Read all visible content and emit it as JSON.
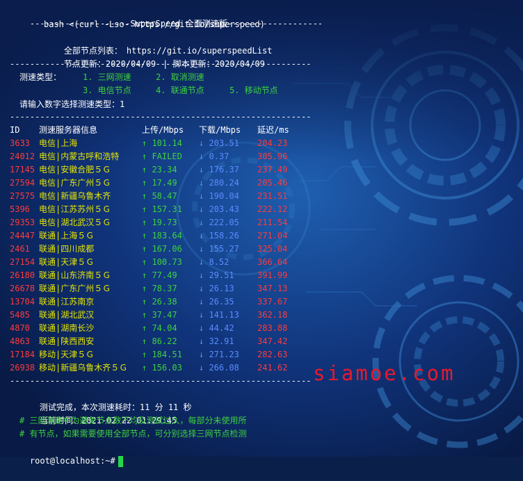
{
  "header": {
    "rule_left": "--------------------",
    "title": "SuperSpeed 全面测速版",
    "rule_right": "-------------------",
    "bash_cmd": "bash <(curl -Lso- https://git.io/superspeed)",
    "list_label": "全部节点列表：",
    "list_url": "https://git.io/superspeedList",
    "node_update": "节点更新：2020/04/09",
    "script_update": "| 脚本更新：2020/04/09"
  },
  "separator": "------------------------------------------------------------",
  "menu": {
    "type_label": "测速类型：",
    "opt1": "1. 三网测速",
    "opt2": "2. 取消测速",
    "opt3": "3. 电信节点",
    "opt4": "4. 联通节点",
    "opt5": "5. 移动节点",
    "prompt": "请输入数字选择测速类型：1"
  },
  "table": {
    "headers": {
      "id": "ID",
      "name": "测速服务器信息",
      "up": "上传/Mbps",
      "down": "下载/Mbps",
      "lat": "延迟/ms"
    },
    "rows": [
      {
        "id": "3633",
        "name": "电信|上海",
        "up": "↑ 101.14",
        "down": "↓ 203.51",
        "lat": "204.23"
      },
      {
        "id": "24012",
        "name": "电信|内蒙古呼和浩特",
        "up": "↑ FAILED",
        "down": "↓ 0.37",
        "lat": "305.96"
      },
      {
        "id": "17145",
        "name": "电信|安徽合肥５Ｇ",
        "up": "↑ 23.34",
        "down": "↓ 176.37",
        "lat": "237.49"
      },
      {
        "id": "27594",
        "name": "电信|广东广州５Ｇ",
        "up": "↑ 17.49",
        "down": "↓ 280.24",
        "lat": "205.46"
      },
      {
        "id": "27575",
        "name": "电信|新疆乌鲁木齐",
        "up": "↑ 58.47",
        "down": "↓ 190.04",
        "lat": "231.51"
      },
      {
        "id": "5396",
        "name": "电信|江苏苏州５Ｇ",
        "up": "↑ 157.31",
        "down": "↓ 203.43",
        "lat": "222.12"
      },
      {
        "id": "29353",
        "name": "电信|湖北武汉５Ｇ",
        "up": "↑ 19.73",
        "down": "↓ 222.05",
        "lat": "211.54"
      },
      {
        "id": "24447",
        "name": "联通|上海５Ｇ",
        "up": "↑ 183.64",
        "down": "↓ 158.26",
        "lat": "271.04"
      },
      {
        "id": "2461",
        "name": "联通|四川成都",
        "up": "↑ 167.06",
        "down": "↓ 155.27",
        "lat": "325.04"
      },
      {
        "id": "27154",
        "name": "联通|天津５Ｇ",
        "up": "↑ 100.73",
        "down": "↓ 8.52",
        "lat": "366.64"
      },
      {
        "id": "26180",
        "name": "联通|山东济南５Ｇ",
        "up": "↑ 77.49",
        "down": "↓ 29.51",
        "lat": "391.99"
      },
      {
        "id": "26678",
        "name": "联通|广东广州５Ｇ",
        "up": "↑ 78.37",
        "down": "↓ 26.13",
        "lat": "347.13"
      },
      {
        "id": "13704",
        "name": "联通|江苏南京",
        "up": "↑ 26.38",
        "down": "↓ 26.35",
        "lat": "337.67"
      },
      {
        "id": "5485",
        "name": "联通|湖北武汉",
        "up": "↑ 37.47",
        "down": "↓ 141.13",
        "lat": "362.18"
      },
      {
        "id": "4870",
        "name": "联通|湖南长沙",
        "up": "↑ 74.04",
        "down": "↓ 44.42",
        "lat": "283.88"
      },
      {
        "id": "4863",
        "name": "联通|陕西西安",
        "up": "↑ 86.22",
        "down": "↓ 32.91",
        "lat": "347.42"
      },
      {
        "id": "17184",
        "name": "移动|天津５Ｇ",
        "up": "↑ 184.51",
        "down": "↓ 271.23",
        "lat": "282.63"
      },
      {
        "id": "26938",
        "name": "移动|新疆乌鲁木齐５Ｇ",
        "up": "↑ 156.03",
        "down": "↓ 266.08",
        "lat": "241.62"
      }
    ]
  },
  "footer": {
    "done_label": "测试完成，本次测速耗时：",
    "done_time": "11 分 11 秒",
    "now_label": "当前时间：",
    "now_time": "2021-02-22 01:29:45",
    "note1": "# 三网测速中为避免节点数不均及测试过久，每部分未使用所",
    "note2": "# 有节点，如果需要使用全部节点，可分别选择三网节点检测",
    "prompt": "root@localhost:~#"
  },
  "watermark": "siamoe.com",
  "colors": {
    "background": "#0a1f4a",
    "green": "#3ed23e",
    "yellow": "#e6e600",
    "red": "#ff3b3b",
    "cyan": "#47c8d6",
    "blue": "#5a8cff",
    "watermark": "#e8192c",
    "cursor": "#22d84a"
  }
}
